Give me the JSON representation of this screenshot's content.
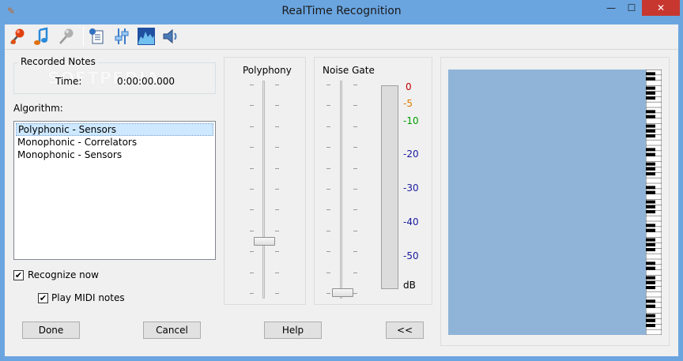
{
  "window": {
    "title": "RealTime Recognition",
    "minimize_glyph": "—",
    "maximize_glyph": "☐",
    "close_glyph": "✕"
  },
  "toolbar": {
    "icons": [
      "microphone-record-icon",
      "music-note-icon",
      "microphone-disabled-icon",
      "document-settings-icon",
      "tuning-sliders-icon",
      "spectrum-icon",
      "speaker-icon"
    ]
  },
  "recorded_notes": {
    "legend": "Recorded Notes",
    "time_label": "Time:",
    "time_value": "0:00:00.000"
  },
  "watermark": "SOFTPEDIA",
  "algorithm": {
    "label": "Algorithm:",
    "options": [
      "Polyphonic - Sensors",
      "Monophonic - Correlators",
      "Monophonic - Sensors"
    ],
    "selected_index": 0
  },
  "checkboxes": {
    "recognize_now": {
      "label": "Recognize now",
      "checked": true
    },
    "play_midi": {
      "label": "Play MIDI notes",
      "checked": true
    }
  },
  "polyphony": {
    "title": "Polyphony",
    "level": 0.25
  },
  "noise_gate": {
    "title": "Noise Gate",
    "level": 0.0,
    "db_scale": [
      {
        "label": "0",
        "color": "#c00000"
      },
      {
        "label": "-5",
        "color": "#e07800"
      },
      {
        "label": "-10",
        "color": "#00a000"
      },
      {
        "label": "-20",
        "color": "#1a1aa0"
      },
      {
        "label": "-30",
        "color": "#1a1aa0"
      },
      {
        "label": "-40",
        "color": "#1a1aa0"
      },
      {
        "label": "-50",
        "color": "#1a1aa0"
      },
      {
        "label": "dB",
        "color": "#000000"
      }
    ]
  },
  "buttons": {
    "done": "Done",
    "cancel": "Cancel",
    "help": "Help",
    "collapse": "<<"
  },
  "colors": {
    "titlebar": "#6aa5e0",
    "close": "#c7372f",
    "piano_bg": "#90b4d8"
  }
}
